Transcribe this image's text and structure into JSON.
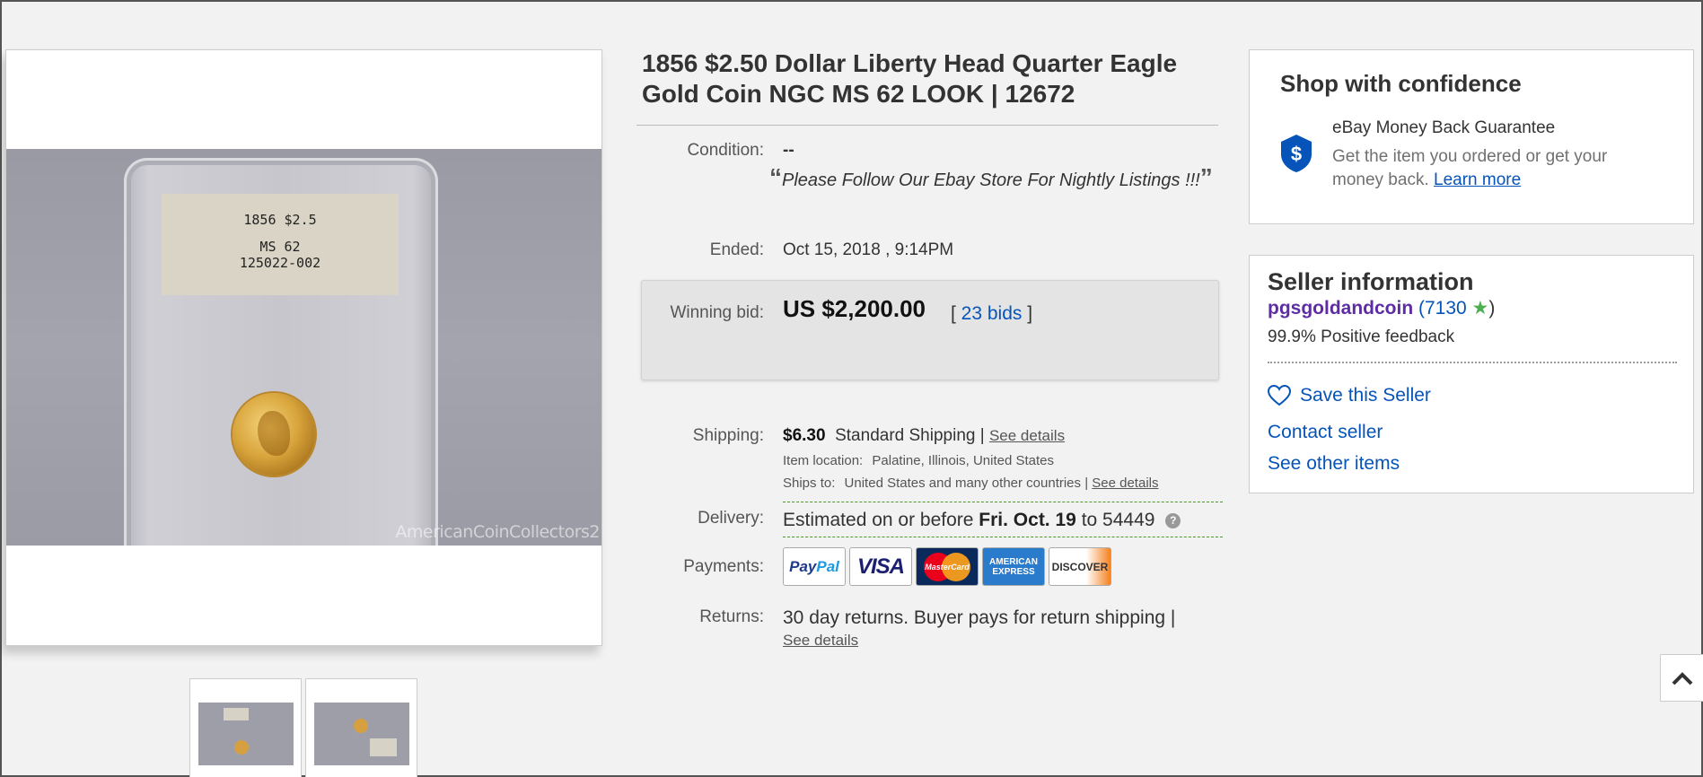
{
  "gallery": {
    "slab_label_line1": "1856 $2.5",
    "slab_label_line2": "MS 62",
    "slab_label_line3": "125022-002",
    "watermark": "AmericanCoinCollectors2"
  },
  "item": {
    "title": "1856 $2.50 Dollar Liberty Head Quarter Eagle Gold Coin NGC MS 62 LOOK | 12672",
    "condition_label": "Condition:",
    "condition_value": "--",
    "condition_quote": "Please Follow Our Ebay Store For Nightly Listings !!!",
    "ended_label": "Ended:",
    "ended_value": "Oct 15, 2018 , 9:14PM",
    "winning_bid_label": "Winning bid:",
    "winning_bid_amount": "US $2,200.00",
    "bids_open": "[ ",
    "bids_link": "23 bids",
    "bids_close": " ]",
    "shipping_label": "Shipping:",
    "shipping_price": "$6.30",
    "shipping_method": "Standard Shipping |",
    "see_details": "See details",
    "item_location_label": "Item location:",
    "item_location_value": "Palatine, Illinois, United States",
    "ships_to_label": "Ships to:",
    "ships_to_value": "United States and many other countries |",
    "delivery_label": "Delivery:",
    "delivery_prefix": "Estimated on or before",
    "delivery_date": "Fri. Oct. 19",
    "delivery_suffix": "to 54449",
    "payments_label": "Payments:",
    "payment_methods": [
      "PayPal",
      "VISA",
      "MasterCard",
      "AMERICAN EXPRESS",
      "DISCOVER"
    ],
    "returns_label": "Returns:",
    "returns_value": "30 day returns. Buyer pays for return shipping |"
  },
  "confidence": {
    "title": "Shop with confidence",
    "guarantee_title": "eBay Money Back Guarantee",
    "guarantee_text": "Get the item you ordered or get your money back.",
    "learn_more": "Learn more",
    "icon": "shield-dollar-icon",
    "accent": "#0654ba"
  },
  "seller": {
    "title": "Seller information",
    "name": "pgsgoldandcoin",
    "feedback_open": " (",
    "feedback_score": "7130",
    "feedback_close": ")",
    "positive": "99.9% Positive feedback",
    "save": "Save this Seller",
    "contact": "Contact seller",
    "other_items": "See other items",
    "name_color": "#5e2ca5",
    "star_color": "#4caf50"
  }
}
